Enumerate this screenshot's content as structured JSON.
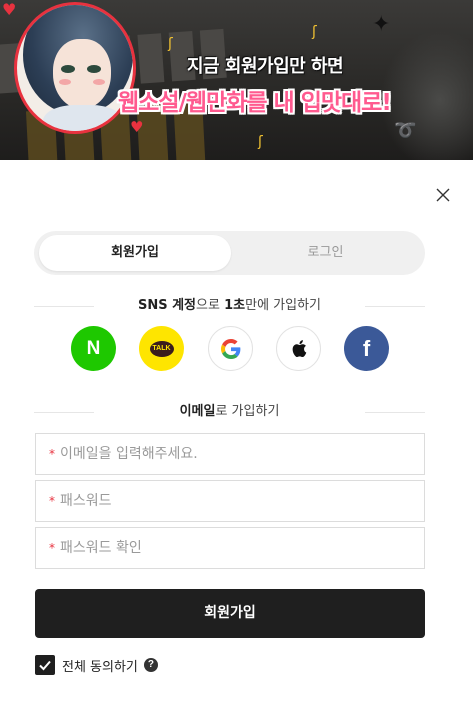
{
  "banner": {
    "headline_line1": "지금 회원가입만 하면",
    "headline_line2": "웹소설/웹만화를 내 입맛대로!",
    "accent_color": "#ff5a8f"
  },
  "modal": {
    "close_icon": "close-icon"
  },
  "tabs": [
    {
      "label": "회원가입",
      "active": true
    },
    {
      "label": "로그인",
      "active": false
    }
  ],
  "sns_section": {
    "label_bold1": "SNS 계정",
    "label_mid": "으로 ",
    "label_bold2": "1초",
    "label_rest": "만에 가입하기"
  },
  "social_buttons": [
    {
      "name": "naver",
      "glyph": "N",
      "color": "#1ec800"
    },
    {
      "name": "kakao",
      "glyph": "TALK",
      "color": "#fee500"
    },
    {
      "name": "google",
      "icon": "google-icon"
    },
    {
      "name": "apple",
      "icon": "apple-icon"
    },
    {
      "name": "facebook",
      "glyph": "f",
      "color": "#3b5998"
    }
  ],
  "email_section": {
    "label_bold": "이메일",
    "label_rest": "로 가입하기"
  },
  "form": {
    "required_mark": "*",
    "email_placeholder": "이메일을 입력해주세요.",
    "password_placeholder": "패스워드",
    "password_confirm_placeholder": "패스워드 확인",
    "submit_label": "회원가입"
  },
  "agree": {
    "label": "전체 동의하기",
    "checked": true,
    "help_glyph": "?"
  }
}
